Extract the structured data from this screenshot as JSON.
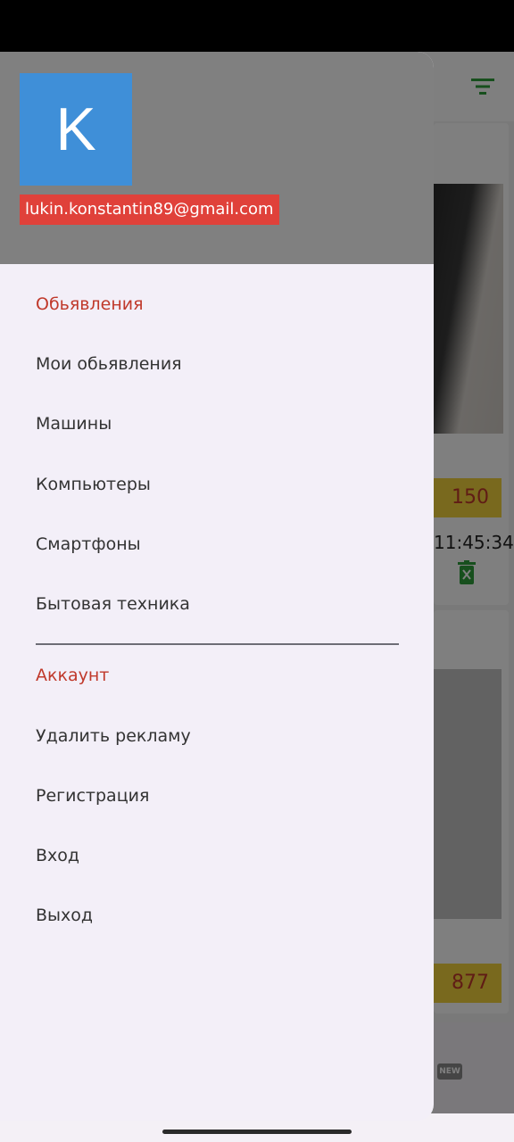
{
  "drawer": {
    "avatar_letter": "K",
    "email": "lukin.konstantin89@gmail.com",
    "section_ads": "Обьявления",
    "ads_items": [
      "Мои обьявления",
      "Машины",
      "Компьютеры",
      "Смартфоны",
      "Бытовая техника"
    ],
    "section_account": "Аккаунт",
    "account_items": [
      "Удалить рекламу",
      "Регистрация",
      "Вход",
      "Выход"
    ]
  },
  "background": {
    "card1_price": "150",
    "card1_time": "11:45:34",
    "card2_price": "877",
    "new_badge": "NEW"
  },
  "colors": {
    "section_title": "#c0392b",
    "avatar_bg": "#3f8fd8",
    "email_bg": "#e0413a",
    "drawer_bg": "#f3eff8",
    "price_bg": "#f2d23c",
    "accent_green": "#2e9e3a"
  },
  "icons": {
    "filter": "filter-icon",
    "trash": "trash-icon"
  }
}
